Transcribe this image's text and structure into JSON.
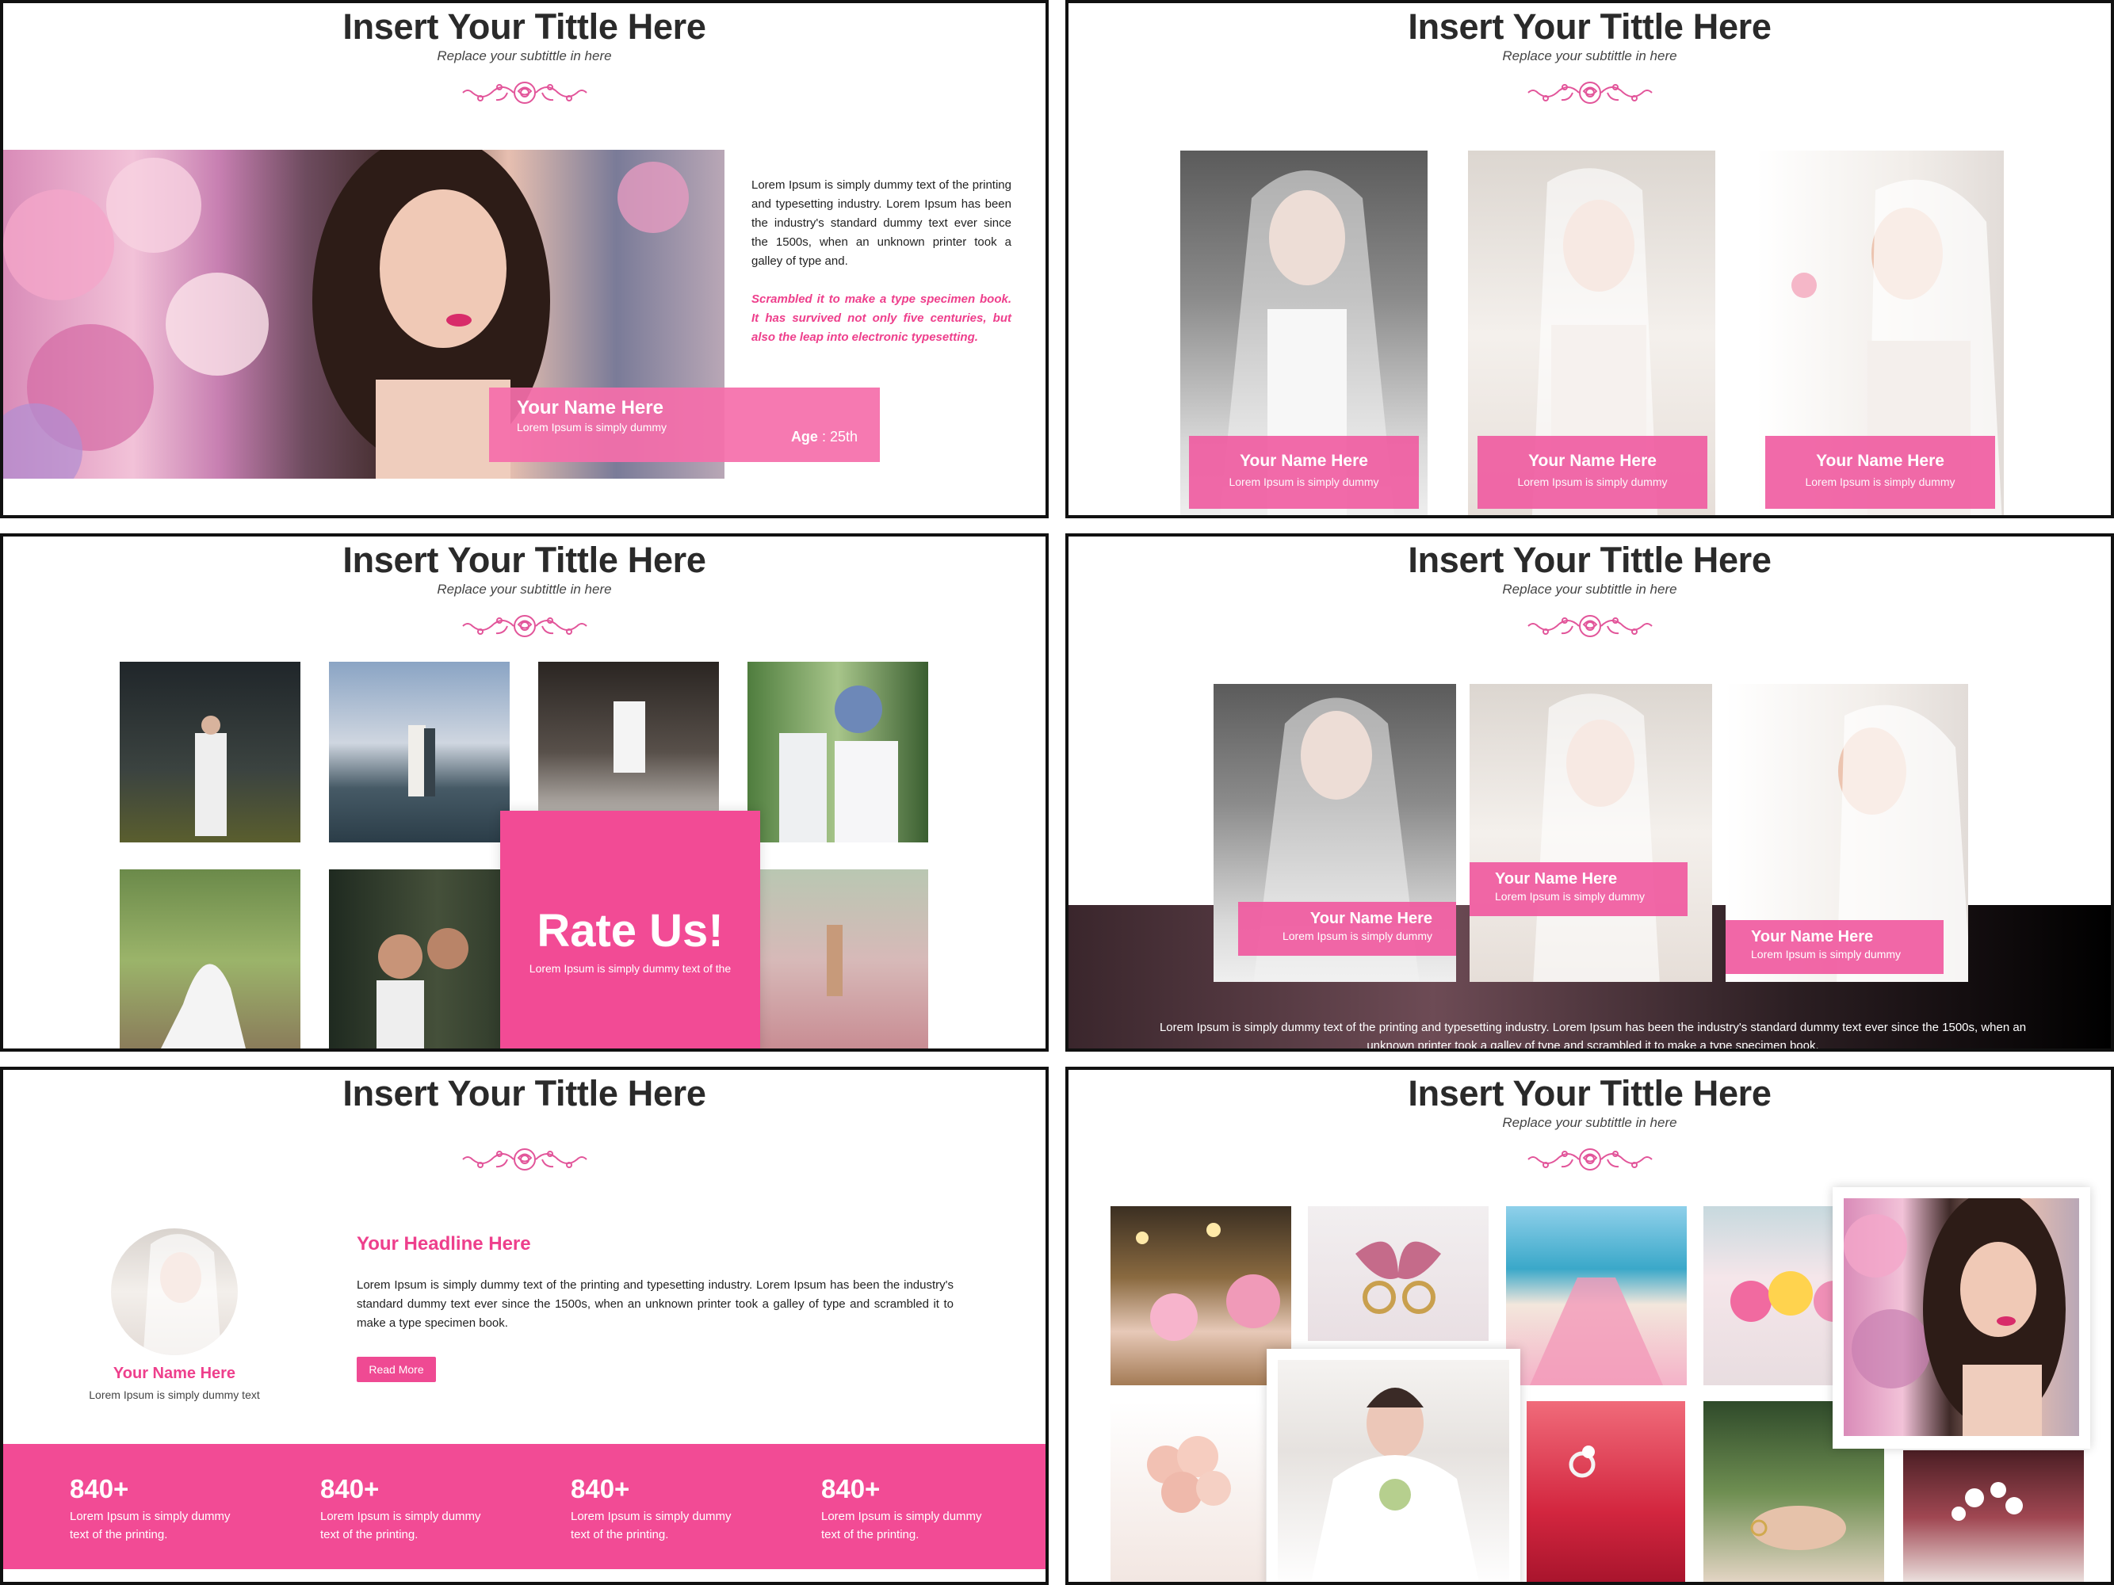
{
  "slides": {
    "s1": {
      "title": "Insert Your Tittle Here",
      "subtitle": "Replace your subtittle in here",
      "paragraph1": "Lorem Ipsum is simply dummy text of the printing and typesetting industry. Lorem Ipsum has been the industry's standard dummy text ever since the 1500s, when an unknown printer took a galley of type and.",
      "paragraph2": "Scrambled it to make a type specimen book. It has survived not only five centuries, but also the leap into electronic typesetting.",
      "card_name": "Your Name Here",
      "card_desc": "Lorem Ipsum is simply dummy",
      "age_label": "Age",
      "age_value": " : 25th"
    },
    "s2": {
      "title": "Insert Your Tittle Here",
      "subtitle": "Replace your subtittle in here",
      "cards": [
        {
          "name": "Your Name Here",
          "desc": "Lorem Ipsum is simply dummy"
        },
        {
          "name": "Your Name Here",
          "desc": "Lorem Ipsum is simply dummy"
        },
        {
          "name": "Your Name Here",
          "desc": "Lorem Ipsum is simply dummy"
        }
      ]
    },
    "s3": {
      "title": "Insert Your Tittle Here",
      "subtitle": "Replace your subtittle in here",
      "rate_title": "Rate Us!",
      "rate_desc": "Lorem Ipsum is simply dummy text of the"
    },
    "s4": {
      "title": "Insert Your Tittle Here",
      "subtitle": "Replace your subtittle in here",
      "cards": [
        {
          "name": "Your Name Here",
          "desc": "Lorem Ipsum is simply dummy"
        },
        {
          "name": "Your Name Here",
          "desc": "Lorem Ipsum is simply dummy"
        },
        {
          "name": "Your Name Here",
          "desc": "Lorem Ipsum is simply dummy"
        }
      ],
      "footer_line1": "Lorem Ipsum is simply dummy text of the printing and typesetting industry. Lorem Ipsum has been the industry's standard dummy text ever since the 1500s, when an",
      "footer_line2": "unknown printer took a galley of type and scrambled it to make a type specimen book."
    },
    "s5": {
      "title": "Insert Your Tittle Here",
      "profile_name": "Your Name Here",
      "profile_desc": "Lorem Ipsum is simply dummy text",
      "headline": "Your Headline Here",
      "paragraph": "Lorem Ipsum is simply dummy text of the printing and typesetting industry. Lorem Ipsum has been the industry's standard dummy text ever since the 1500s, when an unknown printer took a galley of type and scrambled it to make a type specimen book.",
      "button_label": "Read More",
      "stats": [
        {
          "num": "840+",
          "line1": "Lorem Ipsum is simply dummy",
          "line2": "text of the printing."
        },
        {
          "num": "840+",
          "line1": "Lorem Ipsum is simply dummy",
          "line2": "text of the printing."
        },
        {
          "num": "840+",
          "line1": "Lorem Ipsum is simply dummy",
          "line2": "text of the printing."
        },
        {
          "num": "840+",
          "line1": "Lorem Ipsum is simply dummy",
          "line2": "text of the printing."
        }
      ]
    },
    "s6": {
      "title": "Insert Your Tittle Here",
      "subtitle": "Replace your subtittle in here"
    }
  },
  "colors": {
    "accent_pink": "#f0509c",
    "text_dark": "#2a2a2a",
    "border": "#111111"
  }
}
